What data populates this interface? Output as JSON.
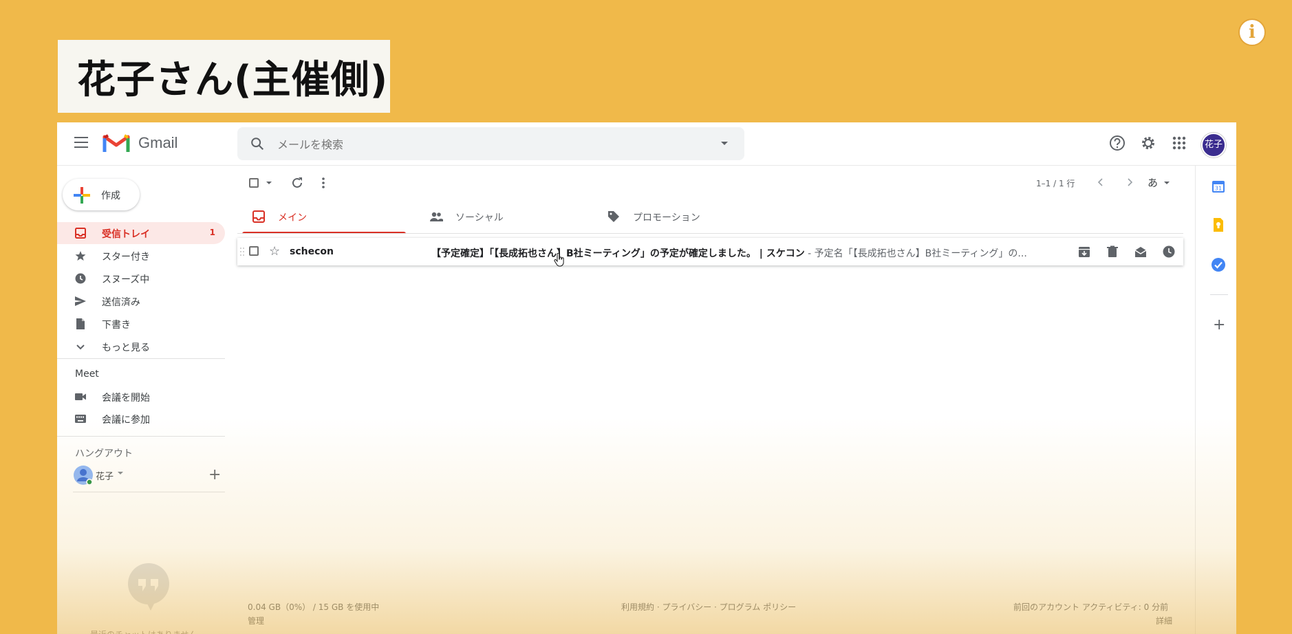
{
  "overlay": {
    "title": "花子さん(主催側)",
    "info_icon": "i"
  },
  "app": {
    "logo_text": "Gmail",
    "search_placeholder": "メールを検索",
    "avatar_text": "花子"
  },
  "compose": {
    "label": "作成"
  },
  "sidebar": {
    "items": [
      {
        "label": "受信トレイ",
        "count": "1",
        "icon": "inbox-icon"
      },
      {
        "label": "スター付き",
        "icon": "star-icon"
      },
      {
        "label": "スヌーズ中",
        "icon": "clock-icon"
      },
      {
        "label": "送信済み",
        "icon": "send-icon"
      },
      {
        "label": "下書き",
        "icon": "draft-icon"
      },
      {
        "label": "もっと見る",
        "icon": "chevron-down-icon"
      }
    ],
    "meet": {
      "heading": "Meet",
      "start": "会議を開始",
      "join": "会議に参加"
    },
    "hangouts": {
      "heading": "ハングアウト",
      "user": "花子",
      "no_chats": "最近のチャットはありません"
    }
  },
  "toolbar": {
    "pager": "1–1 / 1 行",
    "input_tool": "あ"
  },
  "tabs": [
    {
      "label": "メイン",
      "icon": "inbox-icon"
    },
    {
      "label": "ソーシャル",
      "icon": "people-icon"
    },
    {
      "label": "プロモーション",
      "icon": "tag-icon"
    }
  ],
  "email": {
    "sender": "schecon",
    "subject": "【予定確定】「【長成拓也さん】B社ミーティング」の予定が確定しました。 | スケコン",
    "snippet": " - 予定名「【長成拓也さん】B社ミーティング」の..."
  },
  "footer": {
    "storage": "0.04 GB（0%） / 15 GB を使用中",
    "manage": "管理",
    "links": "利用規約 · プライバシー · プログラム ポリシー",
    "activity": "前回のアカウント アクティビティ: 0 分前",
    "details": "詳細"
  },
  "colors": {
    "background": "#f0b94a",
    "accent_red": "#d93025",
    "active_bg": "#fce8e6"
  }
}
